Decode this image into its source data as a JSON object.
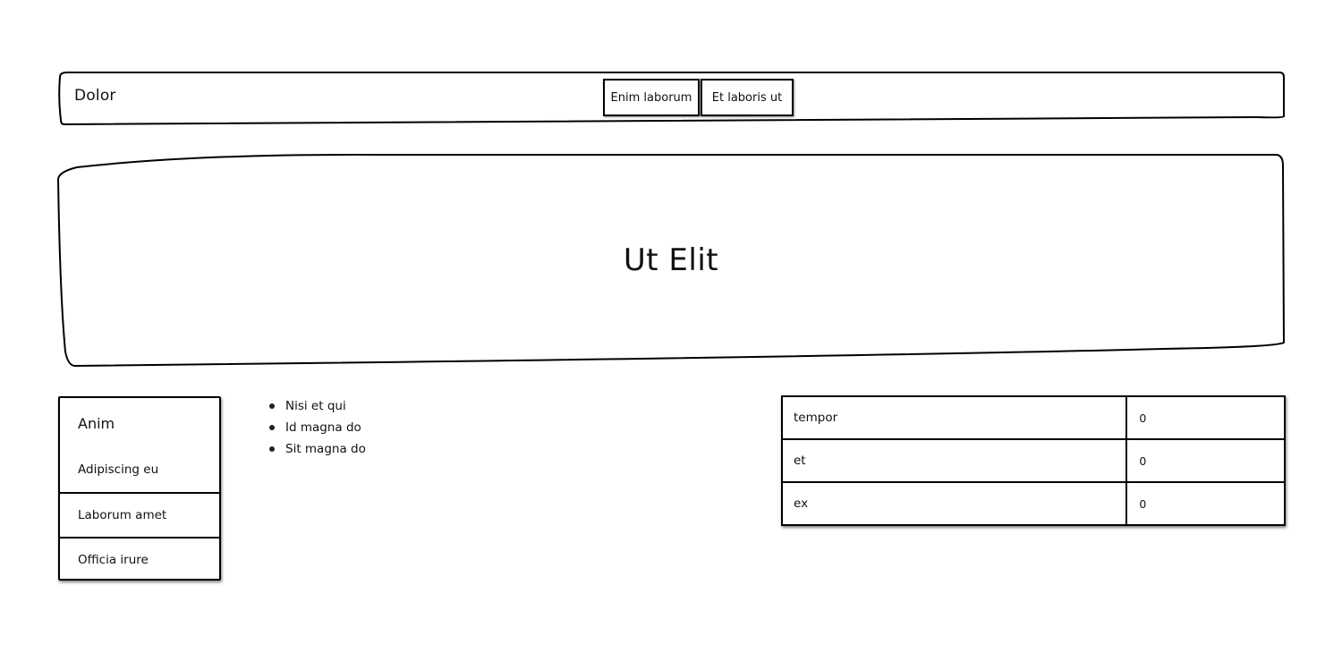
{
  "header": {
    "brand": "Dolor",
    "nav": [
      {
        "label": "Enim laborum"
      },
      {
        "label": "Et laboris ut"
      }
    ]
  },
  "hero": {
    "title": "Ut Elit"
  },
  "sidebar": {
    "title": "Anim",
    "items": [
      {
        "label": "Adipiscing eu"
      },
      {
        "label": "Laborum amet"
      },
      {
        "label": "Officia irure"
      }
    ]
  },
  "list": {
    "items": [
      "Nisi et qui",
      "Id magna do",
      "Sit magna do"
    ]
  },
  "table": {
    "rows": [
      {
        "key": "tempor",
        "value": "0"
      },
      {
        "key": "et",
        "value": "0"
      },
      {
        "key": "ex",
        "value": "0"
      }
    ]
  }
}
